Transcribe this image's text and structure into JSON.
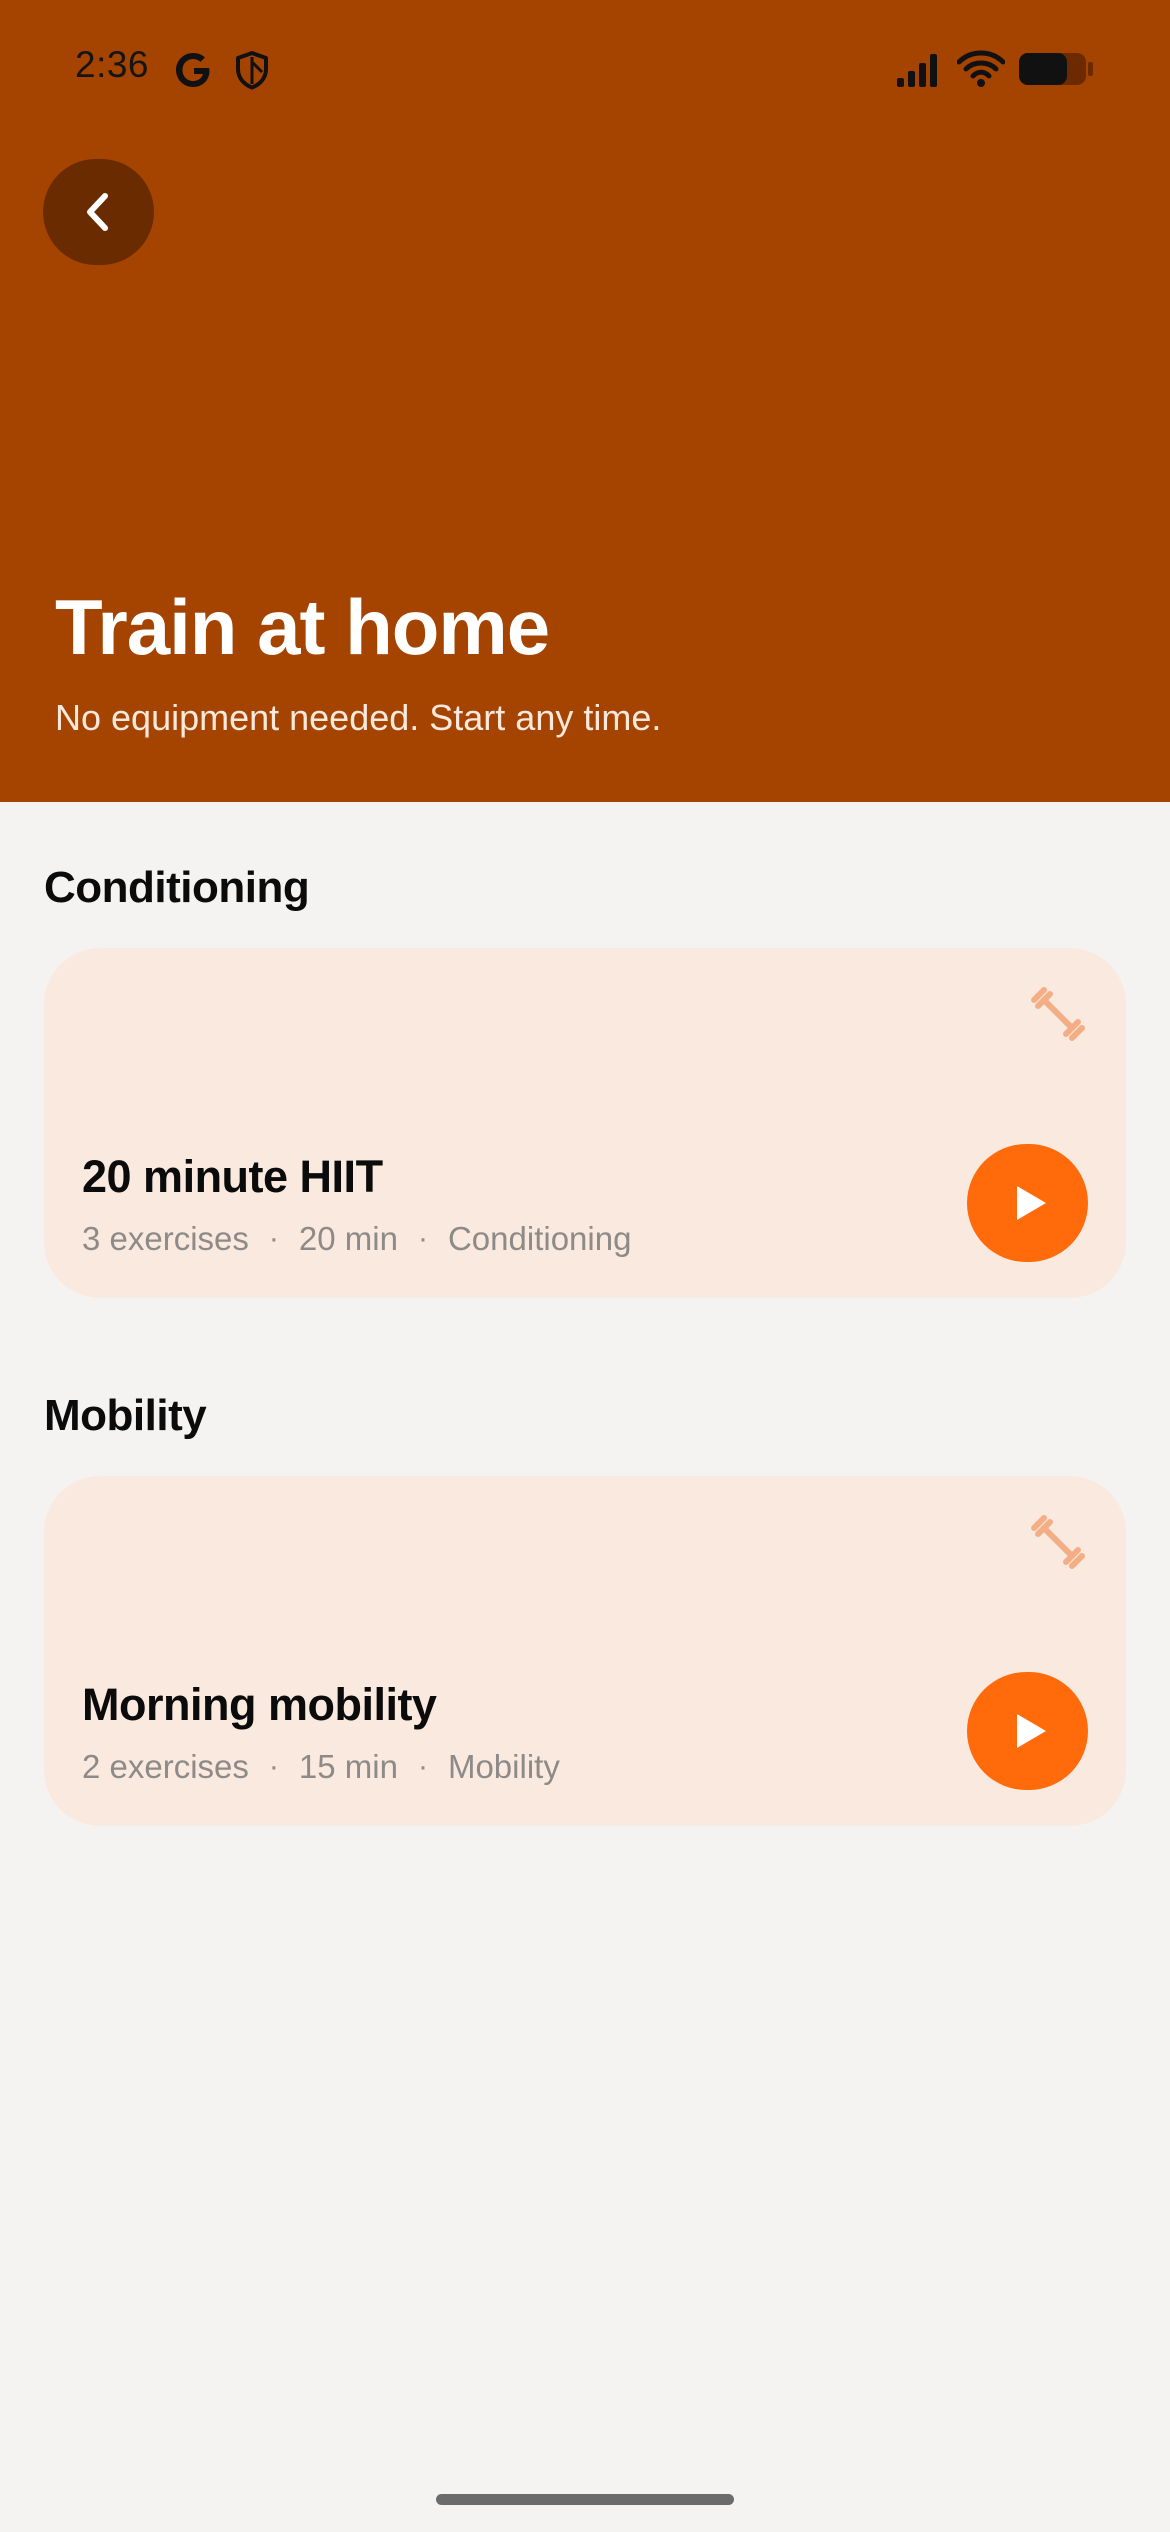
{
  "status_bar": {
    "time": "2:36",
    "icons": [
      "google-icon",
      "shield-icon",
      "signal-icon",
      "wifi-icon",
      "battery-icon"
    ]
  },
  "header": {
    "back_icon": "chevron-left-icon",
    "title": "Train at home",
    "subtitle": "No equipment needed. Start any time."
  },
  "sections": [
    {
      "title": "Conditioning",
      "workout": {
        "title": "20 minute HIIT",
        "exercises": "3 exercises",
        "duration": "20 min",
        "category": "Conditioning",
        "icon": "dumbbell-icon",
        "action_icon": "play-icon"
      }
    },
    {
      "title": "Mobility",
      "workout": {
        "title": "Morning mobility",
        "exercises": "2 exercises",
        "duration": "15 min",
        "category": "Mobility",
        "icon": "dumbbell-icon",
        "action_icon": "play-icon"
      }
    }
  ],
  "meta_separator": "·",
  "colors": {
    "header_bg": "#A54400",
    "back_button_bg": "#6A2B00",
    "page_bg": "#F5F3F1",
    "card_bg": "#FAE9DF",
    "accent": "#FF6A0A",
    "card_icon": "#F4AE86",
    "meta_text": "#8E8A88"
  }
}
